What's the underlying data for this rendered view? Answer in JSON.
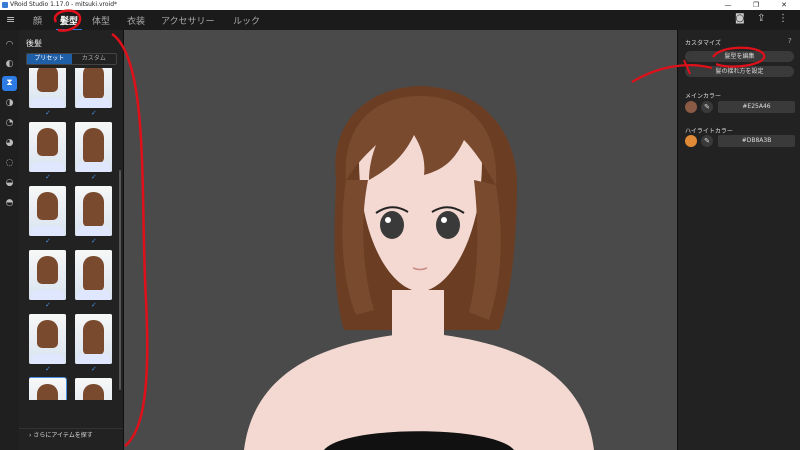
{
  "window": {
    "title": "VRoid Studio 1.17.0 - mitsuki.vroid*",
    "min": "—",
    "max": "❐",
    "close": "✕"
  },
  "nav": {
    "menu_icon": "hamburger-icon",
    "tabs": [
      {
        "label": "顔"
      },
      {
        "label": "髪型"
      },
      {
        "label": "体型"
      },
      {
        "label": "衣装"
      },
      {
        "label": "アクセサリー"
      },
      {
        "label": "ルック"
      }
    ],
    "active_tab": "髪型",
    "icons": [
      "camera-icon",
      "share-icon",
      "more-icon"
    ]
  },
  "rail": {
    "icons": [
      "head-icon",
      "hair-front-icon",
      "hair-back-icon",
      "hair-top-icon",
      "hair-side-icon",
      "ahoge-icon",
      "hair-tail-icon",
      "hair-extra-icon",
      "hair-base-icon"
    ],
    "active_index": 2
  },
  "left_panel": {
    "title": "後髪",
    "segments": [
      {
        "label": "プリセット"
      },
      {
        "label": "カスタム"
      }
    ],
    "active_segment": 0,
    "more_label": "さらにアイテムを探す",
    "selected_index": 10
  },
  "right_panel": {
    "customize_label": "カスタマイズ",
    "edit_hair_button": "髪型を編集",
    "sway_button": "髪の揺れ方を設定",
    "main_color_label": "メインカラー",
    "main_color_hex": "#E25A46",
    "main_color": "#8a5a45",
    "highlight_color_label": "ハイライトカラー",
    "highlight_color_hex": "#DB8A3B",
    "highlight_color": "#e08a38"
  },
  "colors": {
    "accent": "#2d7be5",
    "annotation": "#e0101a",
    "hair": "#7a4a2e"
  }
}
